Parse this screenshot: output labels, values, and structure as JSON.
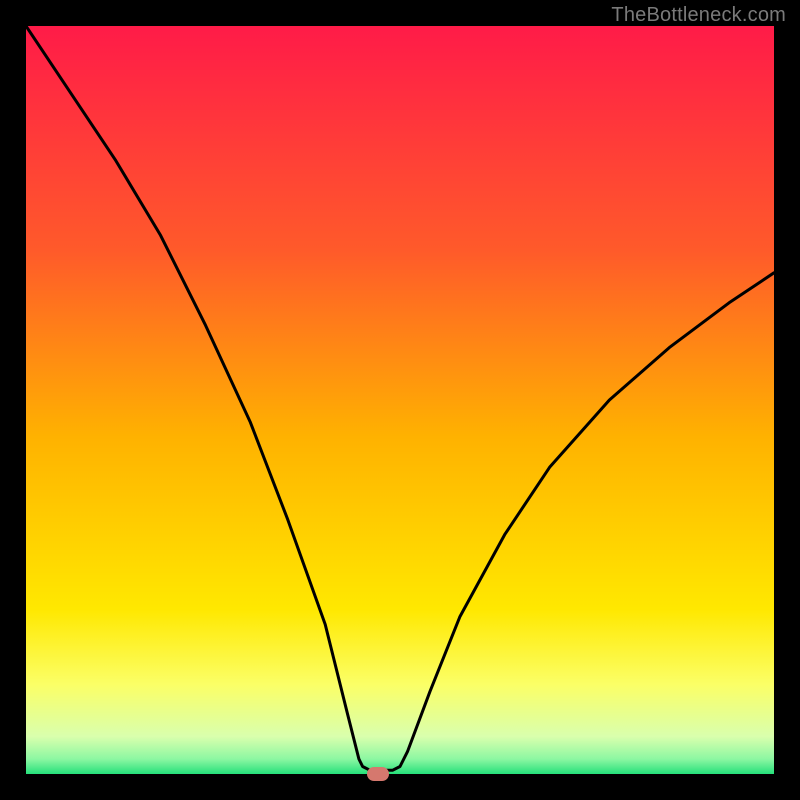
{
  "watermark": "TheBottleneck.com",
  "colors": {
    "gradient_stops": [
      {
        "offset": "0%",
        "color": "#ff1b48"
      },
      {
        "offset": "30%",
        "color": "#ff5a2a"
      },
      {
        "offset": "55%",
        "color": "#ffb200"
      },
      {
        "offset": "78%",
        "color": "#ffe800"
      },
      {
        "offset": "88%",
        "color": "#fbff66"
      },
      {
        "offset": "95%",
        "color": "#d9ffad"
      },
      {
        "offset": "98%",
        "color": "#8cf7a2"
      },
      {
        "offset": "100%",
        "color": "#25e07a"
      }
    ],
    "curve_stroke": "#000000",
    "marker_fill": "#d5786e"
  },
  "chart_data": {
    "type": "line",
    "title": "",
    "xlabel": "",
    "ylabel": "",
    "xlim": [
      0,
      100
    ],
    "ylim": [
      0,
      100
    ],
    "minimum": {
      "x": 47,
      "y": 0
    },
    "curve": [
      {
        "x": 0,
        "y": 100
      },
      {
        "x": 6,
        "y": 91
      },
      {
        "x": 12,
        "y": 82
      },
      {
        "x": 18,
        "y": 72
      },
      {
        "x": 24,
        "y": 60
      },
      {
        "x": 30,
        "y": 47
      },
      {
        "x": 35,
        "y": 34
      },
      {
        "x": 40,
        "y": 20
      },
      {
        "x": 43,
        "y": 8
      },
      {
        "x": 44.5,
        "y": 2
      },
      {
        "x": 45,
        "y": 1
      },
      {
        "x": 46,
        "y": 0.5
      },
      {
        "x": 49,
        "y": 0.5
      },
      {
        "x": 50,
        "y": 1
      },
      {
        "x": 51,
        "y": 3
      },
      {
        "x": 54,
        "y": 11
      },
      {
        "x": 58,
        "y": 21
      },
      {
        "x": 64,
        "y": 32
      },
      {
        "x": 70,
        "y": 41
      },
      {
        "x": 78,
        "y": 50
      },
      {
        "x": 86,
        "y": 57
      },
      {
        "x": 94,
        "y": 63
      },
      {
        "x": 100,
        "y": 67
      }
    ]
  }
}
